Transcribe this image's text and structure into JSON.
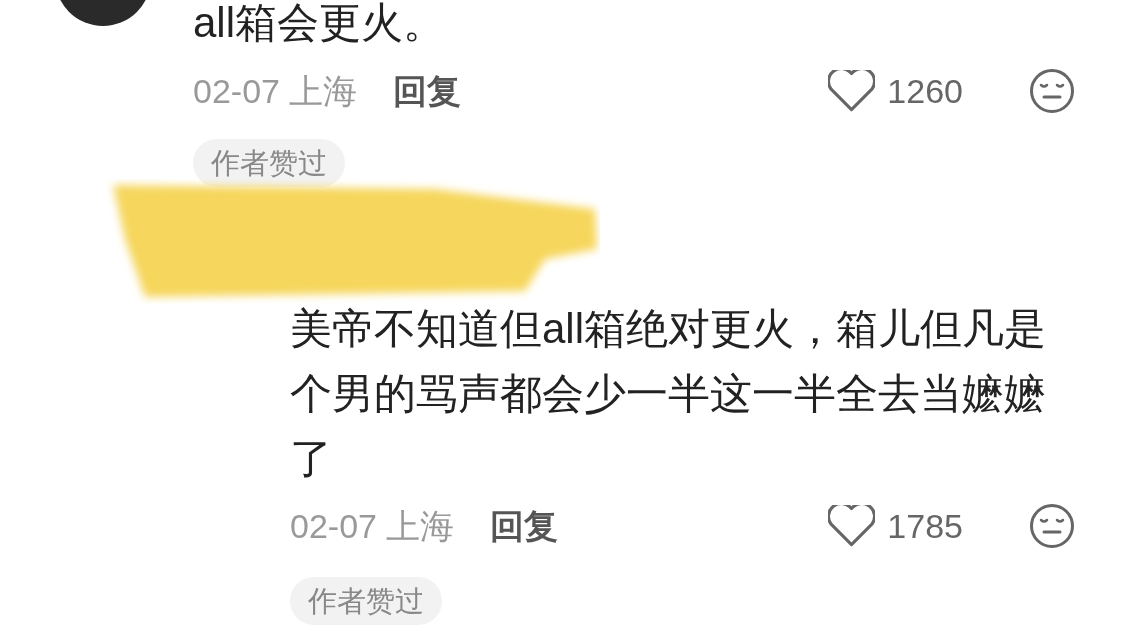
{
  "comments": [
    {
      "kind": "comment",
      "text": "all箱会更火。",
      "date": "02-07",
      "location": "上海",
      "reply": "回复",
      "likes": "1260",
      "liked": false,
      "tag": "作者赞过"
    },
    {
      "kind": "reply",
      "text": "美帝不知道但all箱绝对更火，箱儿但凡是个男的骂声都会少一半这一半全去当嬷嬷了",
      "date": "02-07",
      "location": "上海",
      "reply": "回复",
      "likes": "1785",
      "liked": false,
      "tag": "作者赞过"
    }
  ]
}
